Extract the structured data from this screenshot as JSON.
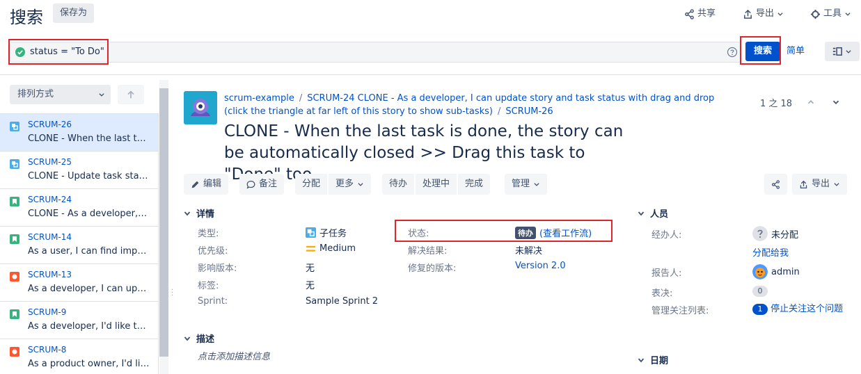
{
  "header": {
    "title": "搜索",
    "save_as": "保存为",
    "share": "共享",
    "export": "导出",
    "tools": "工具"
  },
  "search": {
    "query": "status = \"To Do\"",
    "search_button": "搜索",
    "simple_link": "简单"
  },
  "sidebar": {
    "sort_label": "排列方式",
    "issues": [
      {
        "key": "SCRUM-26",
        "summary": "CLONE - When the last task is done, the story can be automatically closed",
        "type": "subtask",
        "type_color": "#4bade8",
        "selected": true
      },
      {
        "key": "SCRUM-25",
        "summary": "CLONE - Update task status by dragging",
        "type": "subtask",
        "type_color": "#4bade8",
        "selected": false
      },
      {
        "key": "SCRUM-24",
        "summary": "CLONE - As a developer, I can update story",
        "type": "story",
        "type_color": "#36b37e",
        "selected": false
      },
      {
        "key": "SCRUM-14",
        "summary": "As a user, I can find important items",
        "type": "story",
        "type_color": "#36b37e",
        "selected": false
      },
      {
        "key": "SCRUM-13",
        "summary": "As a developer, I can update details",
        "type": "bug",
        "type_color": "#ff5630",
        "selected": false
      },
      {
        "key": "SCRUM-9",
        "summary": "As a developer, I'd like to update",
        "type": "story",
        "type_color": "#36b37e",
        "selected": false
      },
      {
        "key": "SCRUM-8",
        "summary": "As a product owner, I'd like to",
        "type": "bug",
        "type_color": "#ff5630",
        "selected": false
      }
    ]
  },
  "issue": {
    "breadcrumb": {
      "project": "scrum-example",
      "parent": "SCRUM-24 CLONE - As a developer, I can update story and task status with drag and drop (click the triangle at far left of this story to show sub-tasks)",
      "key": "SCRUM-26"
    },
    "title": "CLONE - When the last task is done, the story can be automatically closed >> Drag this task to \"Done\" too",
    "pager": "1 之 18",
    "toolbar": {
      "edit": "编辑",
      "comment": "备注",
      "assign": "分配",
      "more": "更多",
      "todo": "待办",
      "in_progress": "处理中",
      "done": "完成",
      "admin": "管理",
      "export": "导出"
    },
    "details": {
      "heading": "详情",
      "type_label": "类型:",
      "type_value": "子任务",
      "priority_label": "优先级:",
      "priority_value": "Medium",
      "affects_label": "影响版本:",
      "affects_value": "无",
      "labels_label": "标签:",
      "labels_value": "无",
      "sprint_label": "Sprint:",
      "sprint_value": "Sample Sprint 2",
      "status_label": "状态:",
      "status_value": "待办",
      "workflow_link": "(查看工作流)",
      "resolution_label": "解决结果:",
      "resolution_value": "未解决",
      "fix_label": "修复的版本:",
      "fix_value": "Version 2.0"
    },
    "description": {
      "heading": "描述",
      "placeholder": "点击添加描述信息"
    },
    "people": {
      "heading": "人员",
      "assignee_label": "经办人:",
      "assignee_value": "未分配",
      "assign_to_me": "分配给我",
      "reporter_label": "报告人:",
      "reporter_value": "admin",
      "votes_label": "表决:",
      "votes_value": "0",
      "watchers_label": "管理关注列表:",
      "watchers_count": "1",
      "stop_watching": "停止关注这个问题"
    },
    "dates": {
      "heading": "日期"
    }
  },
  "colors": {
    "brand": "#0052cc",
    "highlight": "#e0242b"
  }
}
